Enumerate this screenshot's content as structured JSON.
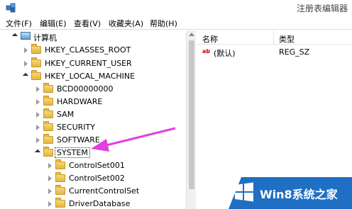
{
  "window": {
    "title": "注册表编辑器"
  },
  "menu": [
    {
      "label": "文件(F)"
    },
    {
      "label": "编辑(E)"
    },
    {
      "label": "查看(V)"
    },
    {
      "label": "收藏夹(A)"
    },
    {
      "label": "帮助(H)"
    }
  ],
  "tree": [
    {
      "label": "计算机",
      "icon": "computer-icon",
      "expanded": true
    },
    {
      "label": "HKEY_CLASSES_ROOT",
      "icon": "folder-icon",
      "expanded": false
    },
    {
      "label": "HKEY_CURRENT_USER",
      "icon": "folder-icon",
      "expanded": false
    },
    {
      "label": "HKEY_LOCAL_MACHINE",
      "icon": "folder-icon",
      "expanded": true
    },
    {
      "label": "BCD00000000",
      "icon": "folder-icon",
      "expanded": false
    },
    {
      "label": "HARDWARE",
      "icon": "folder-icon",
      "expanded": false
    },
    {
      "label": "SAM",
      "icon": "folder-icon",
      "expanded": false
    },
    {
      "label": "SECURITY",
      "icon": "folder-icon",
      "expanded": false
    },
    {
      "label": "SOFTWARE",
      "icon": "folder-icon",
      "expanded": false
    },
    {
      "label": "SYSTEM",
      "icon": "folder-icon",
      "expanded": true,
      "selected": true
    },
    {
      "label": "ControlSet001",
      "icon": "folder-icon",
      "expanded": false
    },
    {
      "label": "ControlSet002",
      "icon": "folder-icon",
      "expanded": false
    },
    {
      "label": "CurrentControlSet",
      "icon": "folder-icon",
      "expanded": false
    },
    {
      "label": "DriverDatabase",
      "icon": "folder-icon",
      "expanded": false
    }
  ],
  "list": {
    "columns": {
      "name": "名称",
      "type": "类型"
    },
    "rows": [
      {
        "icon": "ab",
        "name": "(默认)",
        "type": "REG_SZ"
      }
    ]
  },
  "annotation_arrow_color": "#e040e0",
  "watermark": {
    "text": "Win8系统之家",
    "bg": "#1f6fc4"
  }
}
